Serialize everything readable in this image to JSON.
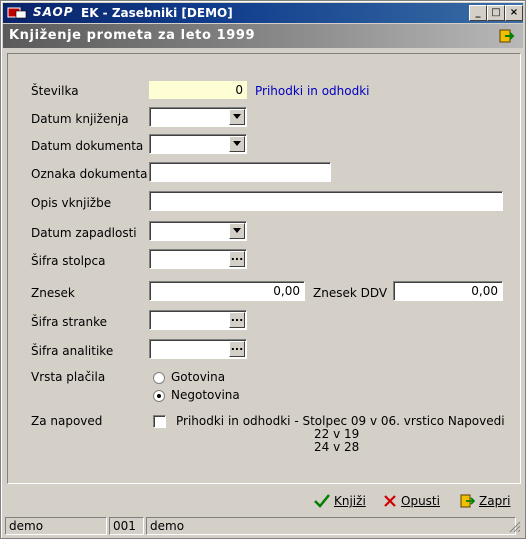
{
  "window": {
    "brand": "SAOP",
    "title": "EK - Zasebniki [DEMO]",
    "minimize": "_",
    "maximize": "□",
    "close": "×"
  },
  "header": {
    "title": "Knjiženje prometa za leto 1999"
  },
  "form": {
    "stevilka": {
      "label": "Številka",
      "value": "0",
      "note": "Prihodki in odhodki"
    },
    "datum_knjizenja": {
      "label": "Datum knjiženja",
      "value": ""
    },
    "datum_dokumenta": {
      "label": "Datum dokumenta",
      "value": ""
    },
    "oznaka_dokumenta": {
      "label": "Oznaka dokumenta",
      "value": ""
    },
    "opis_vknjizbe": {
      "label": "Opis vknjižbe",
      "value": ""
    },
    "datum_zapadlosti": {
      "label": "Datum zapadlosti",
      "value": ""
    },
    "sifra_stolpca": {
      "label": "Šifra stolpca",
      "value": ""
    },
    "znesek": {
      "label": "Znesek",
      "value": "0,00"
    },
    "znesek_ddv": {
      "label": "Znesek DDV",
      "value": "0,00"
    },
    "sifra_stranke": {
      "label": "Šifra stranke",
      "value": ""
    },
    "sifra_analitike": {
      "label": "Šifra analitike",
      "value": ""
    },
    "vrsta_placila": {
      "label": "Vrsta plačila",
      "options": [
        "Gotovina",
        "Negotovina"
      ],
      "selected": "Negotovina"
    },
    "za_napoved": {
      "label": "Za napoved",
      "checked": false,
      "lines": [
        "Prihodki in odhodki - Stolpec 09 v 06. vrstico Napovedi",
        "22 v 19",
        "24 v 28"
      ]
    }
  },
  "buttons": {
    "knjizi": "Knjiži",
    "opusti": "Opusti",
    "zapri": "Zapri"
  },
  "statusbar": [
    "demo",
    "001",
    "demo"
  ],
  "colors": {
    "accent": "#0a246a",
    "note": "#0000c0",
    "yellow_field": "#fffdd4"
  }
}
